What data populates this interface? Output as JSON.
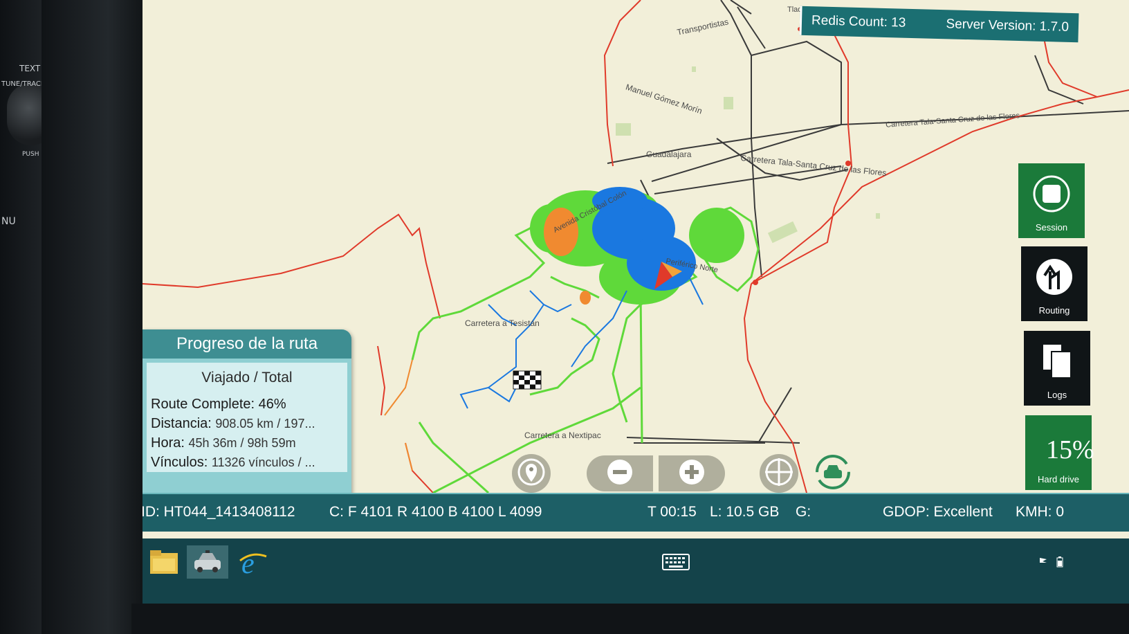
{
  "dashboard": {
    "text_button": "TEXT",
    "tune_track": "TUNE/TRACK",
    "push": "PUSH",
    "menu": "NU"
  },
  "top_bar": {
    "redis_count": "Redis Count: 13",
    "server_version": "Server Version: 1.7.0"
  },
  "side_buttons": {
    "session": "Session",
    "routing": "Routing",
    "logs": "Logs",
    "hard_drive_pct": "15%",
    "hard_drive_label": "Hard drive"
  },
  "map": {
    "labels": {
      "transportistas": "Transportistas",
      "manuel_gomez_morin": "Manuel Gómez Morín",
      "guadalajara": "Guadalajara",
      "carretera_tala_1": "Carretera Tala-Santa Cruz de las Flores",
      "carretera_tala_2": "Carretera Tala-Santa Cruz de las Flores",
      "avenida": "Avenida Cristóbal Colón",
      "norte": "Periférico Norte",
      "tesistan": "Carretera a Tesistán",
      "nextipac": "Carretera a Nextipac",
      "tlaq": "Tlaq"
    }
  },
  "panel": {
    "title": "Progreso de la ruta",
    "subtitle": "Viajado / Total",
    "route_complete_label": "Route Complete:",
    "route_complete_value": "46%",
    "route_complete_fraction": 0.46,
    "distancia_label": "Distancia:",
    "distancia_value": "908.05 km / 197...",
    "hora_label": "Hora:",
    "hora_value": "45h 36m / 98h 59m",
    "vinculos_label": "Vínculos:",
    "vinculos_value": "11326 vínculos / ..."
  },
  "status_bar": {
    "id": "ID: HT044_1413408112",
    "counters": "C: F 4101 R 4100 B 4100 L 4099",
    "time": "T 00:15",
    "storage": "L:  10.5 GB",
    "gps": "G:",
    "gdop": "GDOP: Excellent",
    "speed": "KMH: 0"
  },
  "icons": {
    "location": "map-pin-icon",
    "zoom_out": "minus-icon",
    "zoom_in": "plus-icon",
    "center": "crosshair-icon",
    "car_follow": "car-rotate-icon",
    "finish": "checkered-flag-icon",
    "position": "position-arrow-icon",
    "explorer": "folder-icon",
    "app": "car-app-icon",
    "browser": "internet-explorer-icon",
    "keyboard": "keyboard-icon"
  },
  "colors": {
    "map_bg": "#f2efd9",
    "route_green": "#5fd93a",
    "route_blue": "#1a78e0",
    "route_orange": "#f08a30",
    "road_red": "#e03a2a",
    "road_dark": "#3a3a3a",
    "accent_teal": "#1d5f66",
    "session_green": "#1b7a3a"
  }
}
